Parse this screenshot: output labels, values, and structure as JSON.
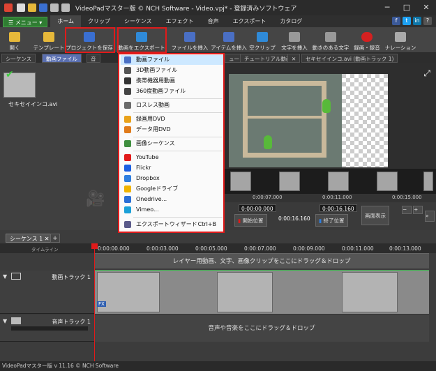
{
  "window": {
    "title": "VideoPadマスター版 © NCH Software - Video.vpj* - 登録済みソフトウェア",
    "minimize": "─",
    "maximize": "□",
    "close": "✕"
  },
  "menu": {
    "menu_button": "☰ メニュー ▾",
    "tabs": [
      "ホーム",
      "クリップ",
      "シーケンス",
      "エフェクト",
      "音声",
      "エクスポート",
      "カタログ"
    ],
    "active_tab": 0
  },
  "social": [
    "f",
    "t",
    "in",
    "?"
  ],
  "toolbar": {
    "open": "開く",
    "template": "テンプレート",
    "save_project": "プロジェクトを保存",
    "export_video": "動画をエクスポート",
    "insert_file": "ファイルを挿入",
    "insert_item": "アイテムを挿入",
    "empty_clip": "空クリップ",
    "insert_text": "文字を挿入",
    "animated_text": "動きのある文字",
    "record": "録画・録音",
    "narration": "ナレーション"
  },
  "bin_tabs": [
    "シーケンス",
    "動画ファイル",
    "音"
  ],
  "preview_tabs": [
    "ュー",
    "チュートリアル動画",
    "✕",
    "セキセイインコ.avi (動画トラック 1)"
  ],
  "media": {
    "clip_name": "セキセイインコ.avi"
  },
  "export_menu": {
    "items": [
      {
        "label": "動画ファイル",
        "icon_color": "#4a6fc4"
      },
      {
        "label": "3D動画ファイル",
        "icon_color": "#555555"
      },
      {
        "label": "携帯機器用動画",
        "icon_color": "#333333"
      },
      {
        "label": "360度動画ファイル",
        "icon_color": "#444444"
      },
      {
        "label": "ロスレス動画",
        "icon_color": "#6b6b6b"
      },
      {
        "label": "録画用DVD",
        "icon_color": "#e9a21b"
      },
      {
        "label": "データ用DVD",
        "icon_color": "#e07b1b"
      },
      {
        "label": "画像シーケンス",
        "icon_color": "#3f8f3f"
      },
      {
        "label": "YouTube",
        "icon_color": "#e21b1b"
      },
      {
        "label": "Flickr",
        "icon_color": "#1b5fe2"
      },
      {
        "label": "Dropbox",
        "icon_color": "#2f7fe0"
      },
      {
        "label": "Googleドライブ",
        "icon_color": "#f0b400"
      },
      {
        "label": "Onedrive...",
        "icon_color": "#2a6fd6"
      },
      {
        "label": "Vimeo...",
        "icon_color": "#1aa0d8"
      },
      {
        "label": "エクスポートウィザード",
        "icon_color": "#5a5a8a"
      }
    ],
    "wizard_shortcut": "Ctrl+B"
  },
  "preview": {
    "ruler_labels": [
      "0:00:07.000",
      "0:00:11.000",
      "0:00:15.000"
    ],
    "start_time": "0:00:00.000",
    "current_time": "0:00:16.160",
    "end_time": "0:00:16.160",
    "start_label": "開始位置",
    "end_label": "終了位置",
    "view_label": "画面表示"
  },
  "timeline": {
    "sequence_tab": "シーケンス 1 ✕",
    "add_tab": "+",
    "header_label": "タイムライン",
    "ticks": [
      "0:00:00.000",
      "0:00:03.000",
      "0:00:05.000",
      "0:00:07.000",
      "0:00:09.000",
      "0:00:11.000",
      "0:00:13.000"
    ],
    "overlay_text": "レイヤー用動画、文字、画像クリップをここにドラッグ＆ドロップ",
    "video_track": "動画トラック 1",
    "audio_track": "音声トラック 1",
    "audio_drop": "音声や音楽をここにドラッグ＆ドロップ",
    "fx": "FX"
  },
  "status": {
    "text": "VideoPadマスター版 v 11.16 © NCH Software"
  }
}
